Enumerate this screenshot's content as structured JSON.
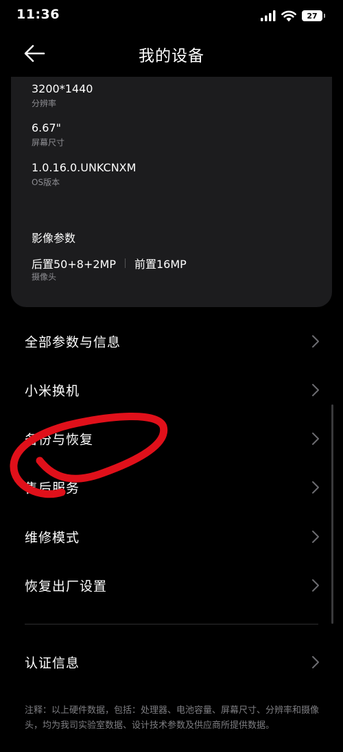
{
  "status_bar": {
    "time": "11:36",
    "battery": "27"
  },
  "header": {
    "title": "我的设备"
  },
  "specs": [
    {
      "value": "3200*1440",
      "label": "分辨率"
    },
    {
      "value": "6.67\"",
      "label": "屏幕尺寸"
    },
    {
      "value": "1.0.16.0.UNKCNXM",
      "label": "OS版本"
    }
  ],
  "camera": {
    "section_title": "影像参数",
    "rear": "后置50+8+2MP",
    "front": "前置16MP",
    "label": "摄像头"
  },
  "menu": [
    {
      "label": "全部参数与信息"
    },
    {
      "label": "小米换机"
    },
    {
      "label": "备份与恢复"
    },
    {
      "label": "售后服务"
    },
    {
      "label": "维修模式"
    },
    {
      "label": "恢复出厂设置"
    },
    {
      "label": "认证信息"
    }
  ],
  "footer": {
    "note": "注释：以上硬件数据，包括：处理器、电池容量、屏幕尺寸、分辨率和摄像头，均为我司实验室数据、设计技术参数及供应商所提供数据。"
  },
  "colors": {
    "background": "#000000",
    "card": "#1c1c1e",
    "secondary_text": "#8e8e93",
    "annotation": "#e0101a"
  }
}
